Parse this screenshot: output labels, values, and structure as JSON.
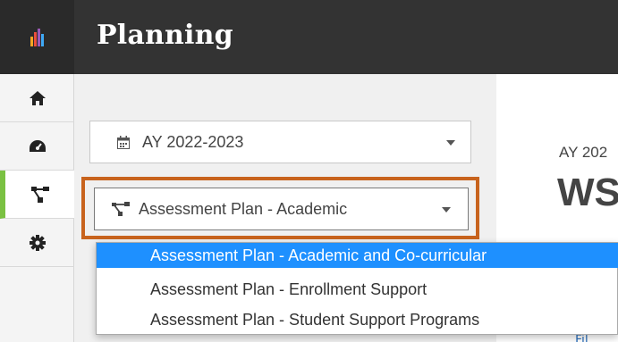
{
  "header": {
    "title": "Planning"
  },
  "sidebar": {
    "items": [
      {
        "icon": "home-icon"
      },
      {
        "icon": "dashboard-gauge-icon"
      },
      {
        "icon": "sitemap-icon",
        "active": true
      },
      {
        "icon": "gear-icon"
      }
    ],
    "active_color": "#7ac142"
  },
  "filters": {
    "year_select": {
      "value": "AY 2022-2023",
      "icon": "calendar-icon"
    },
    "plan_select": {
      "value": "Assessment Plan - Academic",
      "icon": "sitemap-icon",
      "options": [
        {
          "label": "Assessment Plan - Academic and Co-curricular",
          "selected": true
        },
        {
          "label": "Assessment Plan - Enrollment Support",
          "selected": false
        },
        {
          "label": "Assessment Plan - Student Support Programs",
          "selected": false
        }
      ]
    }
  },
  "content": {
    "year_label": "AY 202",
    "heading": "WS",
    "footer_link": "Fil"
  },
  "colors": {
    "topbar": "#333333",
    "highlight_border": "#c8631d",
    "selected_option": "#1e90ff"
  }
}
